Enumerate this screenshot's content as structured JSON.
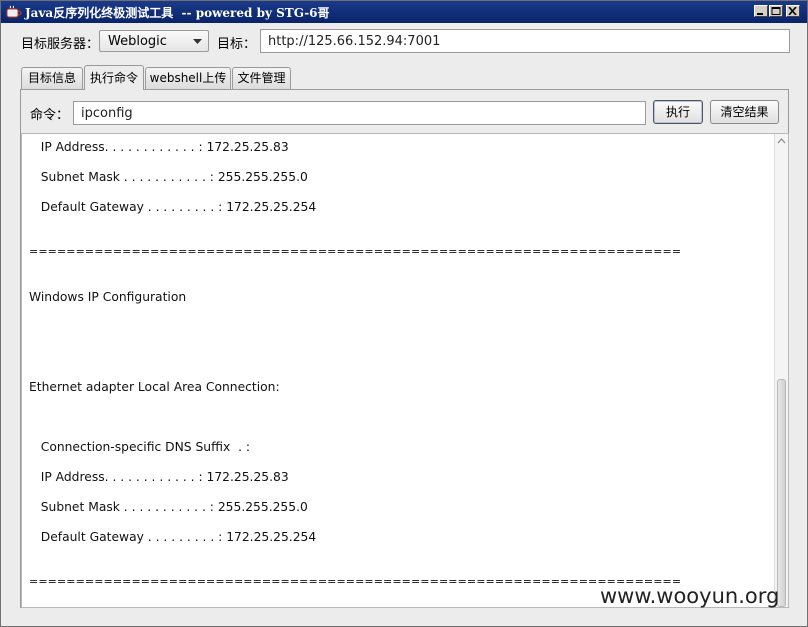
{
  "window": {
    "title": "Java反序列化终极测试工具  -- powered by STG-6哥",
    "buttons": [
      "minimize",
      "maximize",
      "close"
    ]
  },
  "toolbar": {
    "server_label": "目标服务器：",
    "server_value": "Weblogic",
    "target_label": "目标：",
    "target_value": "http://125.66.152.94:7001"
  },
  "tabs": [
    {
      "label": "目标信息",
      "active": false
    },
    {
      "label": "执行命令",
      "active": true
    },
    {
      "label": "webshell上传",
      "active": false
    },
    {
      "label": "文件管理",
      "active": false
    }
  ],
  "command": {
    "label": "命令：",
    "value": "ipconfig",
    "execute_label": "执行",
    "clear_label": "清空结果"
  },
  "output": {
    "lines": [
      "   IP Address. . . . . . . . . . . . : 172.25.25.83",
      "   Subnet Mask . . . . . . . . . . . : 255.255.255.0",
      "   Default Gateway . . . . . . . . . : 172.25.25.254",
      "======================================================================",
      "Windows IP Configuration",
      "Ethernet adapter Local Area Connection:",
      "   Connection-specific DNS Suffix  . :",
      "   IP Address. . . . . . . . . . . . : 172.25.25.83",
      "   Subnet Mask . . . . . . . . . . . : 255.255.255.0",
      "   Default Gateway . . . . . . . . . : 172.25.25.254",
      "======================================================================"
    ]
  },
  "watermark": "www.wooyun.org"
}
